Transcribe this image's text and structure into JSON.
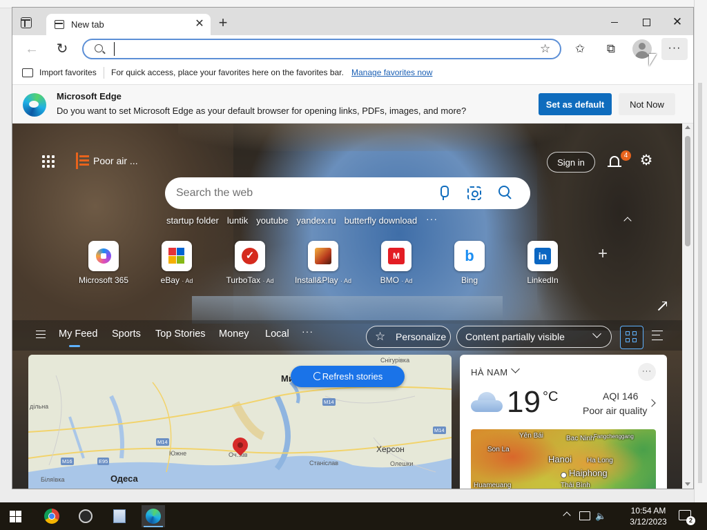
{
  "browser": {
    "tab": {
      "title": "New tab"
    },
    "address_bar": {
      "value": "",
      "placeholder": ""
    },
    "favorites_bar": {
      "import_label": "Import favorites",
      "hint": "For quick access, place your favorites here on the favorites bar.",
      "manage_link": "Manage favorites now"
    },
    "infobar": {
      "title": "Microsoft Edge",
      "message": "Do you want to set Microsoft Edge as your default browser for opening links, PDFs, images, and more?",
      "primary_button": "Set as default",
      "secondary_button": "Not Now"
    }
  },
  "ntp": {
    "air_quality_label": "Poor air ...",
    "sign_in_label": "Sign in",
    "notification_count": "4",
    "search": {
      "placeholder": "Search the web"
    },
    "recent_searches": [
      "startup folder",
      "luntik",
      "youtube",
      "yandex.ru",
      "butterfly download"
    ],
    "quick_links": [
      {
        "name": "Microsoft 365",
        "ad": ""
      },
      {
        "name": "eBay",
        "ad": "· Ad"
      },
      {
        "name": "TurboTax",
        "ad": "· Ad"
      },
      {
        "name": "Install&Play",
        "ad": "· Ad"
      },
      {
        "name": "BMO",
        "ad": "· Ad"
      },
      {
        "name": "Bing",
        "ad": ""
      },
      {
        "name": "LinkedIn",
        "ad": ""
      }
    ],
    "feed_nav": {
      "items": [
        "My Feed",
        "Sports",
        "Top Stories",
        "Money",
        "Local"
      ],
      "active": "My Feed",
      "personalize_label": "Personalize",
      "content_visibility": "Content partially visible"
    },
    "map_card": {
      "refresh_label": "Refresh stories",
      "labels": [
        "Снігурівка",
        "Ми",
        "дільна",
        "Южне",
        "Одеса",
        "Біляївка",
        "Станіслав",
        "Херсон",
        "Олешки",
        "Оч..ків"
      ],
      "road_shields": [
        "M14",
        "M14",
        "M14",
        "M16",
        "E95"
      ]
    },
    "weather_card": {
      "location": "HÀ NAM",
      "temperature": "19",
      "unit": "°C",
      "aqi": "AQI 146",
      "aqi_description": "Poor air quality",
      "map_labels": [
        "Yên Bái",
        "Bac Ninh",
        "Fangchenggang",
        "Son La",
        "Hanoi",
        "Ha Long",
        "Haiphong",
        "Huameuang",
        "Thái Bình"
      ]
    }
  },
  "taskbar": {
    "apps": [
      "chrome-icon",
      "obs-icon",
      "file-explorer-icon",
      "edge-icon"
    ],
    "time": "10:54 AM",
    "date": "3/12/2023",
    "notification_count": "2"
  }
}
